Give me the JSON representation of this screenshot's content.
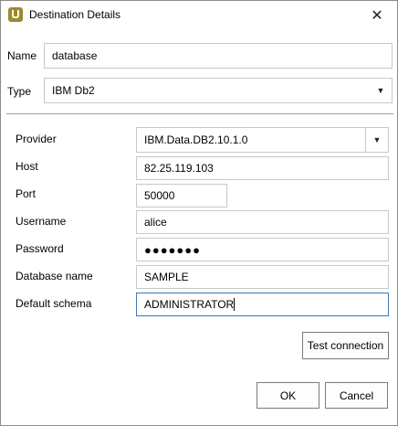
{
  "window": {
    "title": "Destination Details",
    "close_glyph": "✕"
  },
  "top_form": {
    "name_label": "Name",
    "name_value": "database",
    "type_label": "Type",
    "type_value": "IBM Db2"
  },
  "connection": {
    "provider_label": "Provider",
    "provider_value": "IBM.Data.DB2.10.1.0",
    "host_label": "Host",
    "host_value": "82.25.119.103",
    "port_label": "Port",
    "port_value": "50000",
    "username_label": "Username",
    "username_value": "alice",
    "password_label": "Password",
    "password_value": "●●●●●●●",
    "database_label": "Database name",
    "database_value": "SAMPLE",
    "schema_label": "Default schema",
    "schema_value": "ADMINISTRATOR"
  },
  "buttons": {
    "test_connection": "Test connection",
    "ok": "OK",
    "cancel": "Cancel"
  },
  "icons": {
    "app": "app-logo-icon",
    "dropdown": "▼"
  },
  "colors": {
    "app_icon": "#a08a2a",
    "focus_border": "#3d79b6"
  }
}
